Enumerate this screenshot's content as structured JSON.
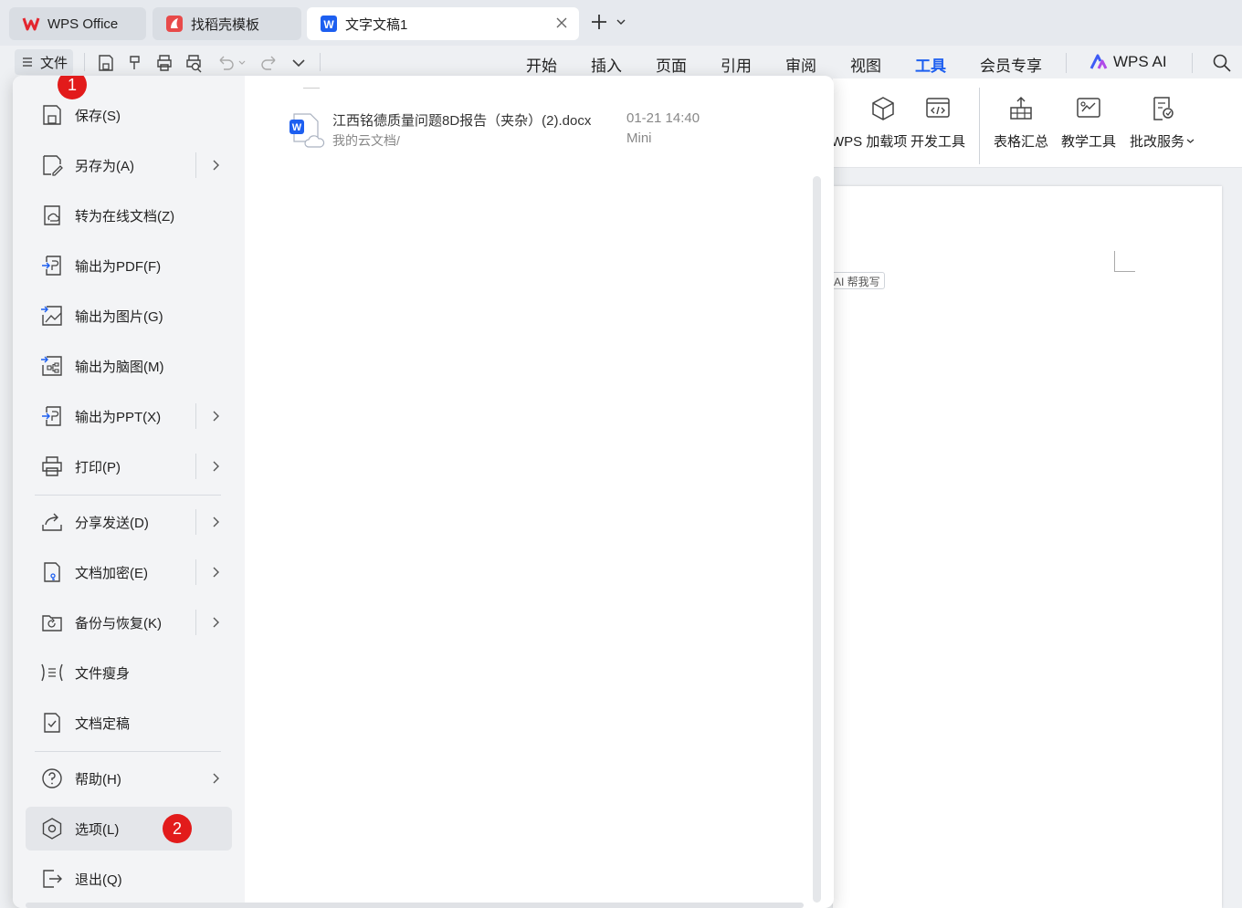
{
  "tabs": [
    {
      "label": "WPS Office",
      "icon": "wps-logo-icon"
    },
    {
      "label": "找稻壳模板",
      "icon": "daoke-icon"
    },
    {
      "label": "文字文稿1",
      "icon": "word-doc-icon",
      "active": true
    }
  ],
  "toolbar": {
    "file_label": "文件",
    "menu_tabs": [
      "开始",
      "插入",
      "页面",
      "引用",
      "审阅",
      "视图",
      "工具",
      "会员专享"
    ],
    "active_tab": "工具",
    "ai_label": "WPS AI"
  },
  "ribbon": {
    "buttons": [
      {
        "label": "WPS 加载项",
        "icon": "addin-icon"
      },
      {
        "label": "开发工具",
        "icon": "dev-tools-icon"
      },
      {
        "label": "表格汇总",
        "icon": "table-summary-icon"
      },
      {
        "label": "教学工具",
        "icon": "teaching-tools-icon"
      },
      {
        "label": "批改服务",
        "icon": "correction-service-icon"
      }
    ]
  },
  "file_menu": {
    "items": [
      {
        "label": "保存(S)",
        "icon": "save-icon",
        "submenu": false
      },
      {
        "label": "另存为(A)",
        "icon": "save-as-icon",
        "submenu": true
      },
      {
        "label": "转为在线文档(Z)",
        "icon": "online-doc-icon",
        "submenu": false
      },
      {
        "label": "输出为PDF(F)",
        "icon": "pdf-export-icon",
        "submenu": false
      },
      {
        "label": "输出为图片(G)",
        "icon": "image-export-icon",
        "submenu": false
      },
      {
        "label": "输出为脑图(M)",
        "icon": "mindmap-export-icon",
        "submenu": false
      },
      {
        "label": "输出为PPT(X)",
        "icon": "ppt-export-icon",
        "submenu": true
      },
      {
        "label": "打印(P)",
        "icon": "print-icon",
        "submenu": true
      },
      {
        "label": "分享发送(D)",
        "icon": "share-icon",
        "submenu": true
      },
      {
        "label": "文档加密(E)",
        "icon": "encrypt-icon",
        "submenu": true
      },
      {
        "label": "备份与恢复(K)",
        "icon": "backup-icon",
        "submenu": true
      },
      {
        "label": "文件瘦身",
        "icon": "slim-icon",
        "submenu": false
      },
      {
        "label": "文档定稿",
        "icon": "finalize-icon",
        "submenu": false
      },
      {
        "label": "帮助(H)",
        "icon": "help-icon",
        "submenu": true
      },
      {
        "label": "选项(L)",
        "icon": "options-icon",
        "submenu": false,
        "highlighted": true
      },
      {
        "label": "退出(Q)",
        "icon": "exit-icon",
        "submenu": false
      }
    ]
  },
  "recent_file": {
    "name": "江西铭德质量问题8D报告（夹杂）(2).docx",
    "path": "我的云文档/",
    "time": "01-21 14:40",
    "device": "Mini"
  },
  "document": {
    "ai_help": "AI 帮我写"
  },
  "annotations": {
    "step1": "1",
    "step2": "2",
    "color": "#e21b1b"
  }
}
